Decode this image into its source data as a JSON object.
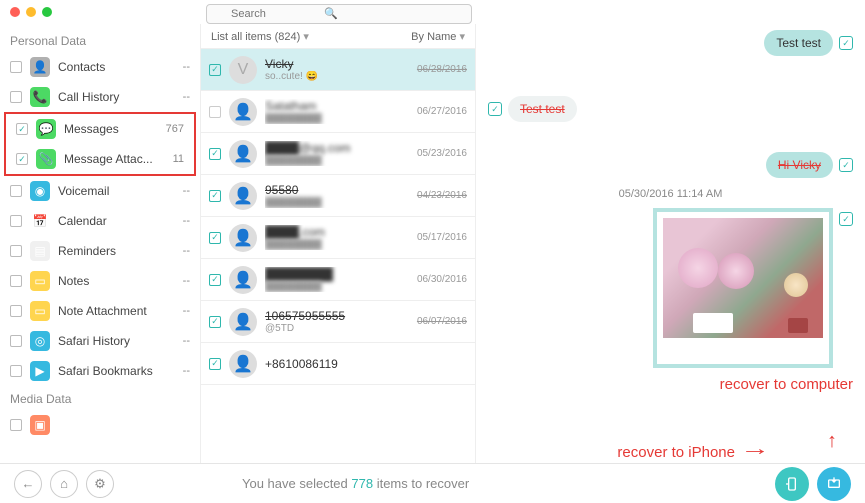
{
  "search": {
    "placeholder": "Search"
  },
  "sidebar": {
    "section1": "Personal Data",
    "section2": "Media Data",
    "items": [
      {
        "label": "Contacts",
        "count": "--",
        "color": "#b0b0b0",
        "checked": false,
        "icon": "👤"
      },
      {
        "label": "Call History",
        "count": "--",
        "color": "#4cd964",
        "checked": false,
        "icon": "📞"
      },
      {
        "label": "Messages",
        "count": "767",
        "color": "#4cd964",
        "checked": true,
        "icon": "💬"
      },
      {
        "label": "Message Attac...",
        "count": "11",
        "color": "#4cd964",
        "checked": true,
        "icon": "📎"
      },
      {
        "label": "Voicemail",
        "count": "--",
        "color": "#36b9e0",
        "checked": false,
        "icon": "◉"
      },
      {
        "label": "Calendar",
        "count": "--",
        "color": "#fff",
        "checked": false,
        "icon": "📅"
      },
      {
        "label": "Reminders",
        "count": "--",
        "color": "#f0f0f0",
        "checked": false,
        "icon": "▤"
      },
      {
        "label": "Notes",
        "count": "--",
        "color": "#ffd54f",
        "checked": false,
        "icon": "▭"
      },
      {
        "label": "Note Attachment",
        "count": "--",
        "color": "#ffd54f",
        "checked": false,
        "icon": "▭"
      },
      {
        "label": "Safari History",
        "count": "--",
        "color": "#36b9e0",
        "checked": false,
        "icon": "◎"
      },
      {
        "label": "Safari Bookmarks",
        "count": "--",
        "color": "#36b9e0",
        "checked": false,
        "icon": "▶"
      }
    ]
  },
  "mid": {
    "list_label": "List all items (824)",
    "sort_label": "By Name",
    "threads": [
      {
        "name": "Vicky",
        "sub": "so..cute! 😄",
        "date": "06/28/2016",
        "checked": true,
        "selected": true,
        "strike": true,
        "avatar": "V"
      },
      {
        "name": "Satatham",
        "sub": "████████",
        "date": "06/27/2016",
        "checked": false,
        "blur": true
      },
      {
        "name": "████@qq.com",
        "sub": "████████",
        "date": "05/23/2016",
        "checked": true,
        "blur": true
      },
      {
        "name": "95580",
        "sub": "████████",
        "date": "04/23/2016",
        "checked": true,
        "strike": true,
        "blur": true
      },
      {
        "name": "████.com",
        "sub": "████████",
        "date": "05/17/2016",
        "checked": true,
        "blur": true
      },
      {
        "name": "████████",
        "sub": "████████",
        "date": "06/30/2016",
        "checked": true,
        "blur": true
      },
      {
        "name": "106575955555",
        "sub": "@5TD",
        "date": "06/07/2016",
        "checked": true,
        "strike": true
      },
      {
        "name": "+8610086119",
        "sub": "",
        "date": "",
        "checked": true
      }
    ]
  },
  "preview": {
    "msg1": "Test test",
    "msg2": "Test test",
    "msg3": "Hi Vicky",
    "timestamp": "05/30/2016 11:14 AM"
  },
  "footer": {
    "text_pre": "You have selected ",
    "count": "778",
    "text_post": " items to recover"
  },
  "annotations": {
    "a1": "recover to iPhone",
    "a2": "recover to computer"
  }
}
